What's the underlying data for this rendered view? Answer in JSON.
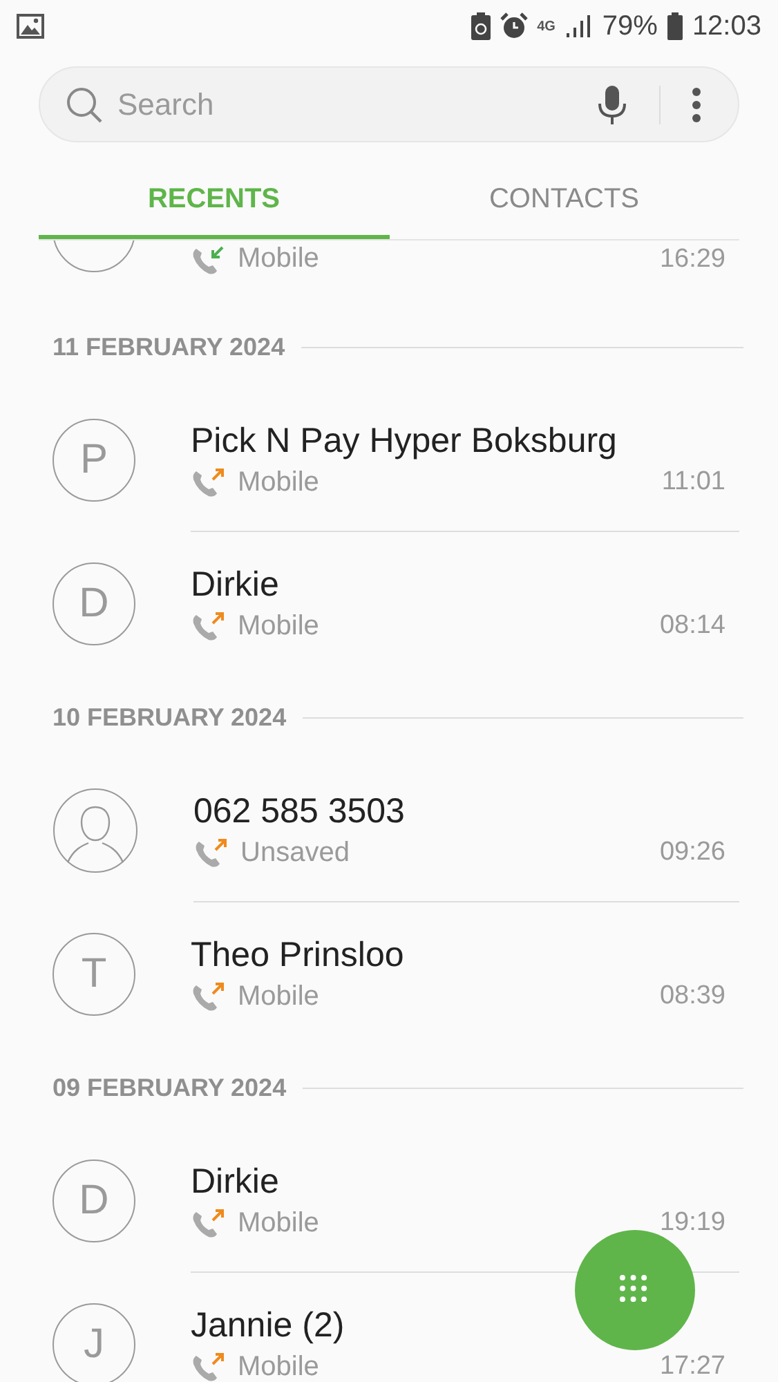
{
  "status_bar": {
    "battery_percent": "79%",
    "time": "12:03",
    "network": "4G"
  },
  "search": {
    "placeholder": "Search"
  },
  "tabs": [
    {
      "label": "RECENTS",
      "selected": true
    },
    {
      "label": "CONTACTS",
      "selected": false
    }
  ],
  "groups": [
    {
      "calls": [
        {
          "avatar": {
            "kind": "partial"
          },
          "kind": "incoming",
          "type": "Mobile",
          "time": "16:29"
        }
      ]
    },
    {
      "date": "11 FEBRUARY 2024",
      "calls": [
        {
          "avatar": {
            "kind": "letter",
            "initial": "P"
          },
          "name": "Pick N Pay Hyper Boksburg",
          "kind": "outgoing",
          "type": "Mobile",
          "time": "11:01"
        },
        {
          "avatar": {
            "kind": "letter",
            "initial": "D"
          },
          "name": "Dirkie",
          "kind": "outgoing",
          "type": "Mobile",
          "time": "08:14"
        }
      ]
    },
    {
      "date": "10 FEBRUARY 2024",
      "calls": [
        {
          "avatar": {
            "kind": "silhouette"
          },
          "name": "062 585 3503",
          "kind": "outgoing",
          "type": "Unsaved",
          "time": "09:26"
        },
        {
          "avatar": {
            "kind": "letter",
            "initial": "T"
          },
          "name": "Theo Prinsloo",
          "kind": "outgoing",
          "type": "Mobile",
          "time": "08:39"
        }
      ]
    },
    {
      "date": "09 FEBRUARY 2024",
      "calls": [
        {
          "avatar": {
            "kind": "letter",
            "initial": "D"
          },
          "name": "Dirkie",
          "kind": "outgoing",
          "type": "Mobile",
          "time": "19:19"
        },
        {
          "avatar": {
            "kind": "letter",
            "initial": "J"
          },
          "name": "Jannie (2)",
          "kind": "outgoing",
          "type": "Mobile",
          "time": "17:27"
        }
      ]
    }
  ]
}
